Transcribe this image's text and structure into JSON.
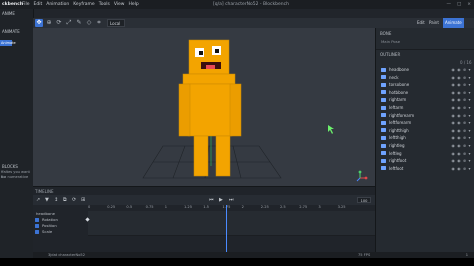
{
  "titlebar": {
    "app_name": "ckbench",
    "menu": [
      "File",
      "Edit",
      "Animation",
      "Keyframe",
      "Tools",
      "View",
      "Help"
    ],
    "window_title": "[q/a] characterNo52 - Blockbench",
    "controls": [
      "—",
      "□",
      "×"
    ]
  },
  "toolbar": {
    "space_select": "Local"
  },
  "modes": {
    "edit": "Edit",
    "paint": "Paint",
    "animate": "Animate"
  },
  "left_panel": {
    "header_1": "ANIME",
    "header_2": "ANIMATE",
    "active_chip": "Animate",
    "section_title": "BLOCKS",
    "hint_lines": [
      "ffaltes you want to",
      "ll a numerative"
    ]
  },
  "right_panel": {
    "bone_label": "BONE",
    "main_pose": "Main Pose",
    "outliner_label": "OUTLINER",
    "outliner_count": "0 / 16",
    "outliner": [
      "headbone",
      "neck",
      "torsobone",
      "hotbbone",
      "rightarm",
      "leftarm",
      "rightforearm",
      "leftforearm",
      "rightthigh",
      "leftthigh",
      "rightleg",
      "leftleg",
      "rightfoot",
      "leftfoot"
    ],
    "row_icons": "◉ ◉ ⊕ ▾"
  },
  "timeline": {
    "title": "TIMELINE",
    "controls": [
      "↗",
      "▼",
      "↕",
      "⧉",
      "⟳",
      "⊞"
    ],
    "transport": [
      "⏮",
      "▶",
      "⏭"
    ],
    "speed_value": "100",
    "ruler": [
      "0",
      "0.25",
      "0.5",
      "0.75",
      "1",
      "1.25",
      "1.5",
      "1.75",
      "2",
      "2.25",
      "2.5",
      "2.75",
      "3",
      "3.25"
    ],
    "bone_name": "headbone",
    "channels": [
      "Rotation",
      "Position",
      "Scale"
    ]
  },
  "statusbar": {
    "left_text": "3jdat characterNo52",
    "fps": "75 FPS",
    "right_text": "1"
  },
  "colors": {
    "accent": "#3c73d4",
    "character": "#f3a400",
    "viewport_bg": "#353a42"
  }
}
